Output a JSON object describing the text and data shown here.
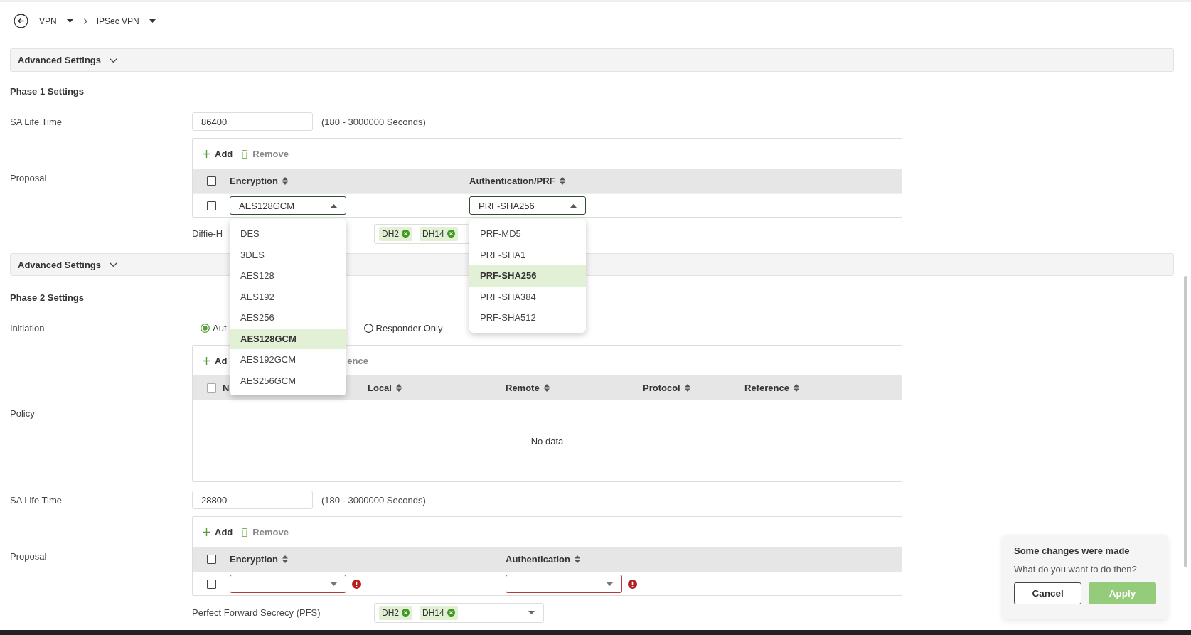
{
  "breadcrumb": [
    {
      "label": "VPN"
    },
    {
      "label": "IPSec VPN"
    }
  ],
  "phase1": {
    "advanced_settings": "Advanced Settings",
    "title": "Phase 1 Settings",
    "sa_life_time": {
      "label": "SA Life Time",
      "value": "86400",
      "hint": "(180 - 3000000 Seconds)"
    },
    "proposal": {
      "label": "Proposal",
      "toolbar": [
        {
          "kind": "add",
          "label": "Add",
          "disabled": false
        },
        {
          "kind": "remove",
          "label": "Remove",
          "disabled": true
        }
      ],
      "columns": [
        "Encryption",
        "Authentication/PRF"
      ],
      "header_checked": false,
      "rows": [
        {
          "checked": false,
          "cells": [
            {
              "value": "AES128GCM",
              "open": true,
              "error": false,
              "options": [
                {
                  "label": "DES",
                  "selected": false
                },
                {
                  "label": "3DES",
                  "selected": false
                },
                {
                  "label": "AES128",
                  "selected": false
                },
                {
                  "label": "AES192",
                  "selected": false
                },
                {
                  "label": "AES256",
                  "selected": false
                },
                {
                  "label": "AES128GCM",
                  "selected": true
                },
                {
                  "label": "AES192GCM",
                  "selected": false
                },
                {
                  "label": "AES256GCM",
                  "selected": false
                }
              ]
            },
            {
              "value": "PRF-SHA256",
              "open": true,
              "error": false,
              "options": [
                {
                  "label": "PRF-MD5",
                  "selected": false
                },
                {
                  "label": "PRF-SHA1",
                  "selected": false
                },
                {
                  "label": "PRF-SHA256",
                  "selected": true
                },
                {
                  "label": "PRF-SHA384",
                  "selected": false
                },
                {
                  "label": "PRF-SHA512",
                  "selected": false
                }
              ]
            }
          ]
        }
      ]
    },
    "dh_group": {
      "label": "Diffie-H",
      "chips": [
        "DH2",
        "DH14"
      ]
    }
  },
  "phase2": {
    "advanced_settings": "Advanced Settings",
    "title": "Phase 2 Settings",
    "initiation": {
      "label": "Initiation",
      "options": [
        {
          "label": "Aut",
          "selected": true
        },
        {
          "label": "Responder Only",
          "selected": false
        }
      ]
    },
    "policy": {
      "label": "Policy",
      "toolbar": [
        {
          "kind": "add",
          "label": "Ad",
          "disabled": false
        },
        {
          "kind": "plain",
          "label": "ence",
          "disabled": true
        }
      ],
      "columns": [
        "N",
        "Local",
        "Remote",
        "Protocol",
        "Reference"
      ],
      "header_checked": false,
      "empty_text": "No data"
    },
    "sa_life_time": {
      "label": "SA Life Time",
      "value": "28800",
      "hint": "(180 - 3000000 Seconds)"
    },
    "proposal": {
      "label": "Proposal",
      "toolbar": [
        {
          "kind": "add",
          "label": "Add",
          "disabled": false
        },
        {
          "kind": "remove",
          "label": "Remove",
          "disabled": true
        }
      ],
      "columns": [
        "Encryption",
        "Authentication"
      ],
      "header_checked": false,
      "rows": [
        {
          "checked": false,
          "cells": [
            {
              "open": false,
              "error": true
            },
            {
              "open": false,
              "error": true
            }
          ]
        }
      ]
    },
    "pfs": {
      "label": "Perfect Forward Secrecy (PFS)",
      "chips": [
        "DH2",
        "DH14"
      ],
      "dropdown": true
    }
  },
  "toast": {
    "title": "Some changes were made",
    "message": "What do you want to do then?",
    "buttons": [
      {
        "label": "Cancel",
        "kind": "secondary"
      },
      {
        "label": "Apply",
        "kind": "primary"
      }
    ]
  }
}
